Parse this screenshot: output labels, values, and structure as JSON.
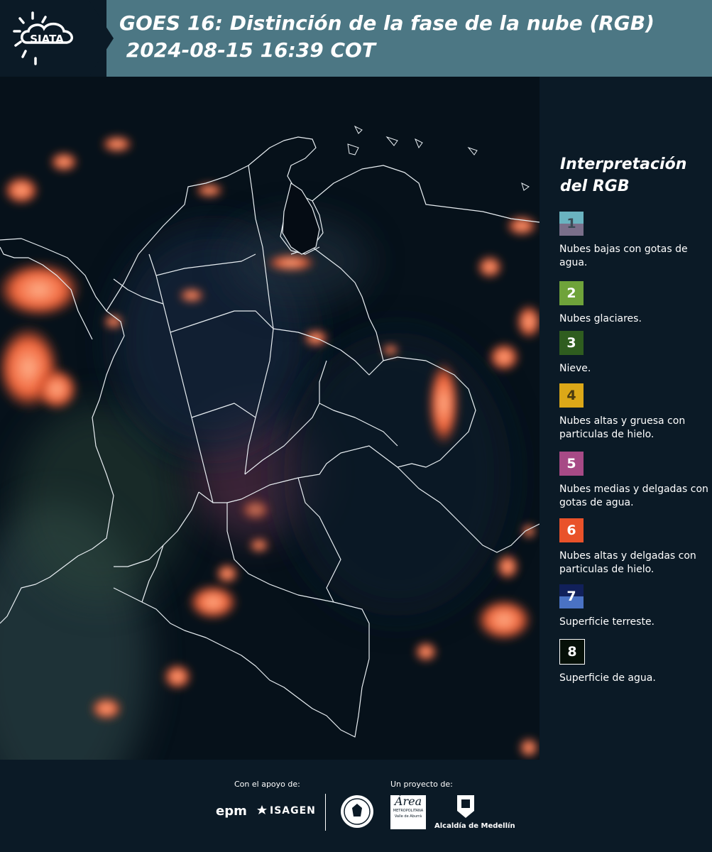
{
  "header": {
    "logo_text": "SIATA",
    "title_line1": "GOES 16: Distinción de la fase de la nube (RGB)",
    "title_line2": " 2024-08-15 16:39 COT"
  },
  "legend": {
    "title_line1": "Interpretación",
    "title_line2": "del RGB",
    "items": [
      {
        "number": "1",
        "label": "Nubes bajas con gotas de agua.",
        "color_top": "#6ab3c0",
        "color_bottom": "#7a6f8a",
        "number_color": "#3a4a55"
      },
      {
        "number": "2",
        "label": "Nubes glaciares.",
        "color_top": "#6fa33a",
        "color_bottom": "#6fa33a",
        "number_color": "#ffffff"
      },
      {
        "number": "3",
        "label": "Nieve.",
        "color_top": "#2f5d1f",
        "color_bottom": "#2f5d1f",
        "number_color": "#ffffff"
      },
      {
        "number": "4",
        "label": "Nubes altas y gruesa con particulas de hielo.",
        "color_top": "#dca818",
        "color_bottom": "#dca818",
        "number_color": "#4a3a10"
      },
      {
        "number": "5",
        "label": "Nubes medias y delgadas con gotas de agua.",
        "color_top": "#a74a86",
        "color_bottom": "#a74a86",
        "number_color": "#ffffff"
      },
      {
        "number": "6",
        "label": "Nubes altas y delgadas con particulas de hielo.",
        "color_top": "#e9522a",
        "color_bottom": "#e9522a",
        "number_color": "#ffffff"
      },
      {
        "number": "7",
        "label": "Superficie terreste.",
        "color_top": "#11205a",
        "color_bottom": "#4a72c4",
        "number_color": "#ffffff"
      },
      {
        "number": "8",
        "label": "Superficie de agua.",
        "color_top": "#061008",
        "color_bottom": "#061008",
        "number_color": "#ffffff"
      }
    ]
  },
  "footer": {
    "support_label": "Con el apoyo de:",
    "project_label": "Un proyecto de:",
    "sponsor1": "epm",
    "sponsor2": "ISAGEN",
    "partner1_line1": "Área",
    "partner1_line2": "METROPOLITANA",
    "partner1_line3": "Valle de Aburrá",
    "partner2": "Alcaldía de Medellín"
  },
  "colors": {
    "header_band": "#4c7784",
    "background": "#0b1a26",
    "cloud_orange": "#f0643a"
  }
}
